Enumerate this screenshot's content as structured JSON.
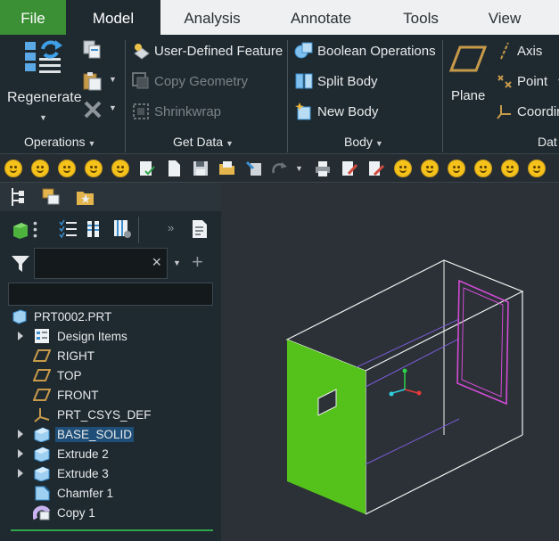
{
  "tabs": {
    "file": "File",
    "model": "Model",
    "analysis": "Analysis",
    "annotate": "Annotate",
    "tools": "Tools",
    "view": "View"
  },
  "ribbon": {
    "regenerate": "Regenerate",
    "groups": {
      "operations": "Operations",
      "get_data": "Get Data",
      "body": "Body",
      "datum": "Dat"
    },
    "get_data": {
      "user_defined_feature": "User-Defined Feature",
      "copy_geometry": "Copy Geometry",
      "shrinkwrap": "Shrinkwrap"
    },
    "body": {
      "boolean_operations": "Boolean Operations",
      "split_body": "Split Body",
      "new_body": "New Body"
    },
    "datum": {
      "plane": "Plane",
      "axis": "Axis",
      "point": "Point",
      "coordinate_system": "Coordin"
    }
  },
  "model_tree": {
    "root": "PRT0002.PRT",
    "items": [
      {
        "label": "Design Items",
        "icon": "design-items-icon",
        "expandable": true
      },
      {
        "label": "RIGHT",
        "icon": "datum-plane-icon",
        "expandable": false
      },
      {
        "label": "TOP",
        "icon": "datum-plane-icon",
        "expandable": false
      },
      {
        "label": "FRONT",
        "icon": "datum-plane-icon",
        "expandable": false
      },
      {
        "label": "PRT_CSYS_DEF",
        "icon": "csys-icon",
        "expandable": false
      },
      {
        "label": "BASE_SOLID",
        "icon": "solid-body-icon",
        "expandable": true,
        "selected": true
      },
      {
        "label": "Extrude 2",
        "icon": "extrude-icon",
        "expandable": true
      },
      {
        "label": "Extrude 3",
        "icon": "extrude-icon",
        "expandable": true
      },
      {
        "label": "Chamfer 1",
        "icon": "chamfer-icon",
        "expandable": false
      },
      {
        "label": "Copy 1",
        "icon": "copy-icon",
        "expandable": false
      }
    ]
  },
  "search": {
    "value": ""
  },
  "colors": {
    "accent_green": "#3b8f35",
    "face_green": "#55c21c",
    "selection_blue": "#1f4f78",
    "ribbon_bg": "#1f2a30",
    "viewport_bg": "#2b3136",
    "edge_magenta": "#d24bd6",
    "edge_purple": "#7a5cd8"
  }
}
